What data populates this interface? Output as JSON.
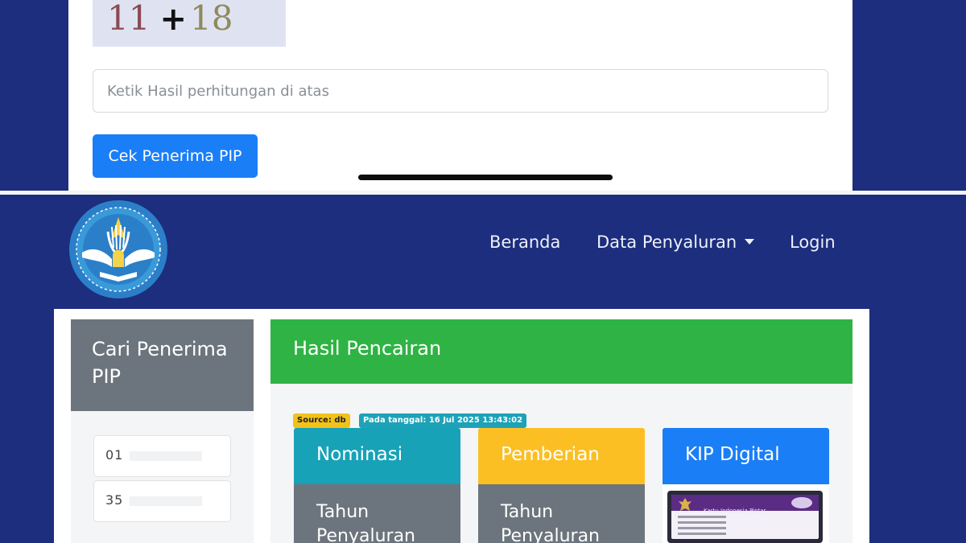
{
  "top": {
    "captcha": {
      "left": "11",
      "operator": "+",
      "right": "18"
    },
    "answer_input": {
      "placeholder": "Ketik Hasil perhitungan di atas",
      "value": ""
    },
    "submit_label": "Cek Penerima PIP"
  },
  "navbar": {
    "items": [
      {
        "label": "Beranda"
      },
      {
        "label": "Data Penyaluran"
      },
      {
        "label": "Login"
      }
    ]
  },
  "search_panel": {
    "title": "Cari Penerima PIP",
    "fields": [
      {
        "value": "01"
      },
      {
        "value": "35"
      }
    ]
  },
  "result": {
    "title": "Hasil Pencairan",
    "badge_source": "Source: db",
    "badge_date": "Pada tanggal: 16 Jul 2025 13:43:02",
    "cards": [
      {
        "title": "Nominasi",
        "body": "Tahun Penyaluran"
      },
      {
        "title": "Pemberian",
        "body": "Tahun Penyaluran"
      },
      {
        "title": "KIP Digital"
      }
    ],
    "kip_card_text": "Kartu Indonesia Pintar"
  },
  "colors": {
    "page_bg": "#1c2e7d",
    "primary": "#1a7ef7",
    "success": "#2fb344",
    "info": "#17a2b8",
    "warning": "#fbbf24",
    "secondary": "#6c757d"
  },
  "icons": [
    "logo-tut-wuri-handayani",
    "caret-down-icon",
    "garuda-emblem-icon"
  ]
}
